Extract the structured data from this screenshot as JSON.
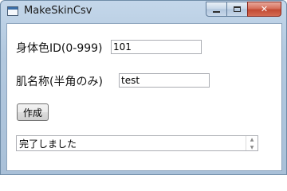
{
  "window": {
    "title": "MakeSkinCsv",
    "icon": "application-window-icon",
    "minimize_glyph": "minimize-icon",
    "maximize_glyph": "maximize-icon",
    "close_glyph": "✕"
  },
  "form": {
    "body_color_label": "身体色ID(0-999)",
    "body_color_value": "101",
    "skin_name_label": "肌名称(半角のみ)",
    "skin_name_value": "test",
    "create_button_label": "作成",
    "status_text": "完了しました",
    "spin_up": "▲",
    "spin_down": "▼"
  },
  "colors": {
    "title_bar": "#b3c9df",
    "close_button": "#c24a34",
    "client_background": "#ffffff"
  }
}
